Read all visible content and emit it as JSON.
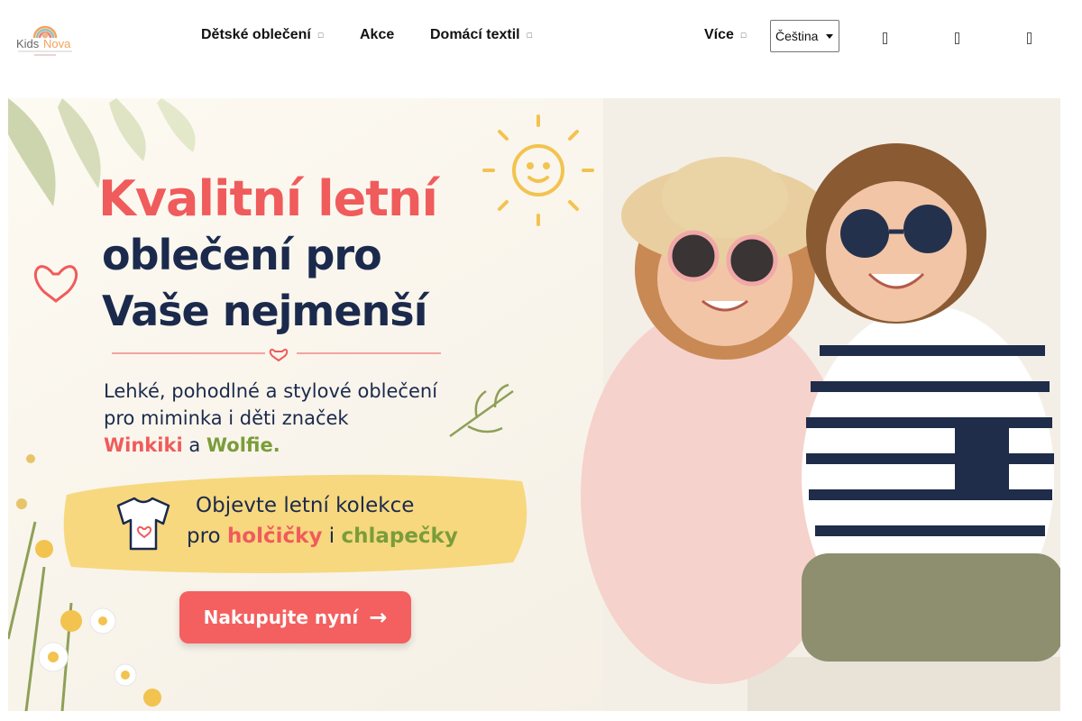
{
  "header": {
    "logo": {
      "name_part1": "Kids",
      "name_part2": "Nova"
    },
    "nav": [
      {
        "label": "Dětské oblečení",
        "has_dropdown": true
      },
      {
        "label": "Akce",
        "has_dropdown": false
      },
      {
        "label": "Domácí textil",
        "has_dropdown": true
      },
      {
        "label": "Více",
        "has_dropdown": true
      }
    ],
    "language": {
      "selected": "Čeština"
    },
    "icons": [
      "search-icon",
      "user-icon",
      "cart-icon"
    ]
  },
  "hero": {
    "headline_line1": "Kvalitní letní",
    "headline_line2": "oblečení pro",
    "headline_line3": "Vaše nejmenší",
    "description_line1": "Lehké, pohodlné a stylové oblečení",
    "description_line2": "pro miminka i děti značek",
    "brand_1": "Winkiki",
    "brand_joiner": "a",
    "brand_2": "Wolfie",
    "brand_end": ".",
    "banner_line1": "Objevte letní kolekce",
    "banner_prefix": "pro",
    "banner_girls": "holčičky",
    "banner_joiner": "i",
    "banner_boys": "chlapečky",
    "cta_label": "Nakupujte nyní",
    "cta_arrow": "→"
  },
  "colors": {
    "accent_coral": "#f05b5c",
    "navy": "#1b2a4c",
    "green": "#7a9d3a",
    "banner_yellow": "#f7d87e"
  }
}
